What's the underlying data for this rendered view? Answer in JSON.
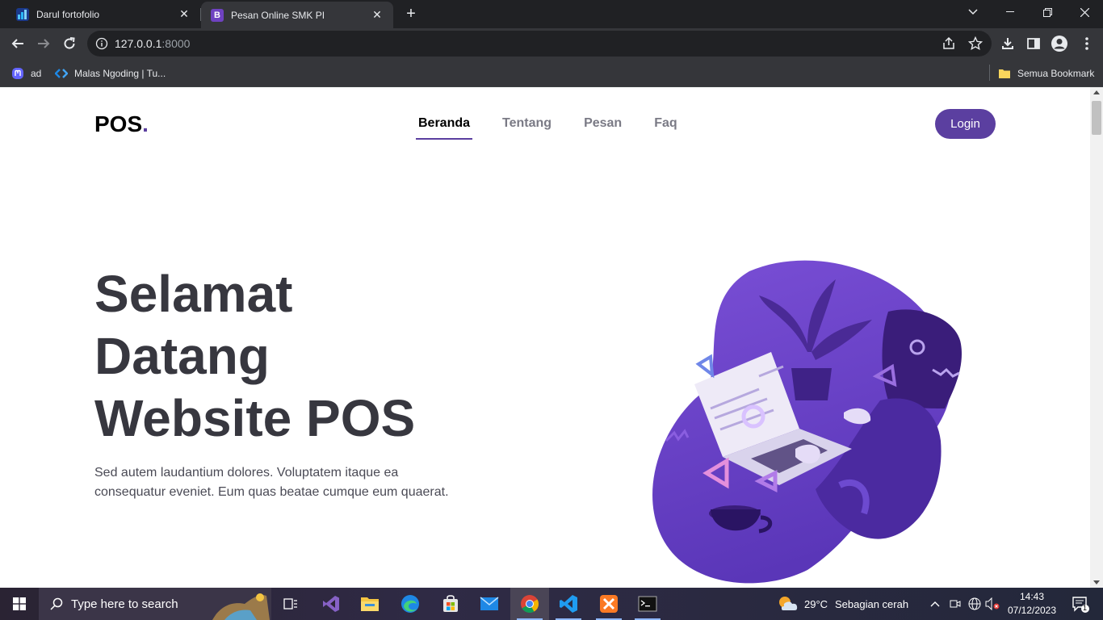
{
  "browser": {
    "tabs": [
      {
        "title": "Darul fortofolio",
        "favicon": "chart-favicon",
        "active": false
      },
      {
        "title": "Pesan Online SMK PI",
        "favicon": "bootstrap-favicon",
        "favicon_letter": "B",
        "active": true
      }
    ],
    "address": {
      "host": "127.0.0.1",
      "port": ":8000"
    },
    "bookmarks": [
      {
        "label": "ad",
        "icon": "mastodon-icon"
      },
      {
        "label": "Malas Ngoding | Tu...",
        "icon": "code-icon"
      }
    ],
    "all_bookmarks_label": "Semua Bookmark"
  },
  "page": {
    "logo": {
      "text": "POS",
      "dot": "."
    },
    "nav": [
      {
        "label": "Beranda",
        "active": true
      },
      {
        "label": "Tentang",
        "active": false
      },
      {
        "label": "Pesan",
        "active": false
      },
      {
        "label": "Faq",
        "active": false
      }
    ],
    "login_label": "Login",
    "hero": {
      "title_lines": [
        "Selamat",
        "Datang",
        "Website POS"
      ],
      "text": "Sed autem laudantium dolores. Voluptatem itaque ea consequatur eveniet. Eum quas beatae cumque eum quaerat."
    },
    "accent_color": "#5b3fa0"
  },
  "taskbar": {
    "search_placeholder": "Type here to search",
    "weather": {
      "temp": "29°C",
      "desc": "Sebagian cerah"
    },
    "time": "14:43",
    "date": "07/12/2023",
    "notification_count": "1",
    "apps": [
      "task-view-icon",
      "visual-studio-icon",
      "file-explorer-icon",
      "edge-icon",
      "store-icon",
      "mail-icon",
      "chrome-icon",
      "vscode-icon",
      "xampp-icon",
      "terminal-icon"
    ]
  }
}
